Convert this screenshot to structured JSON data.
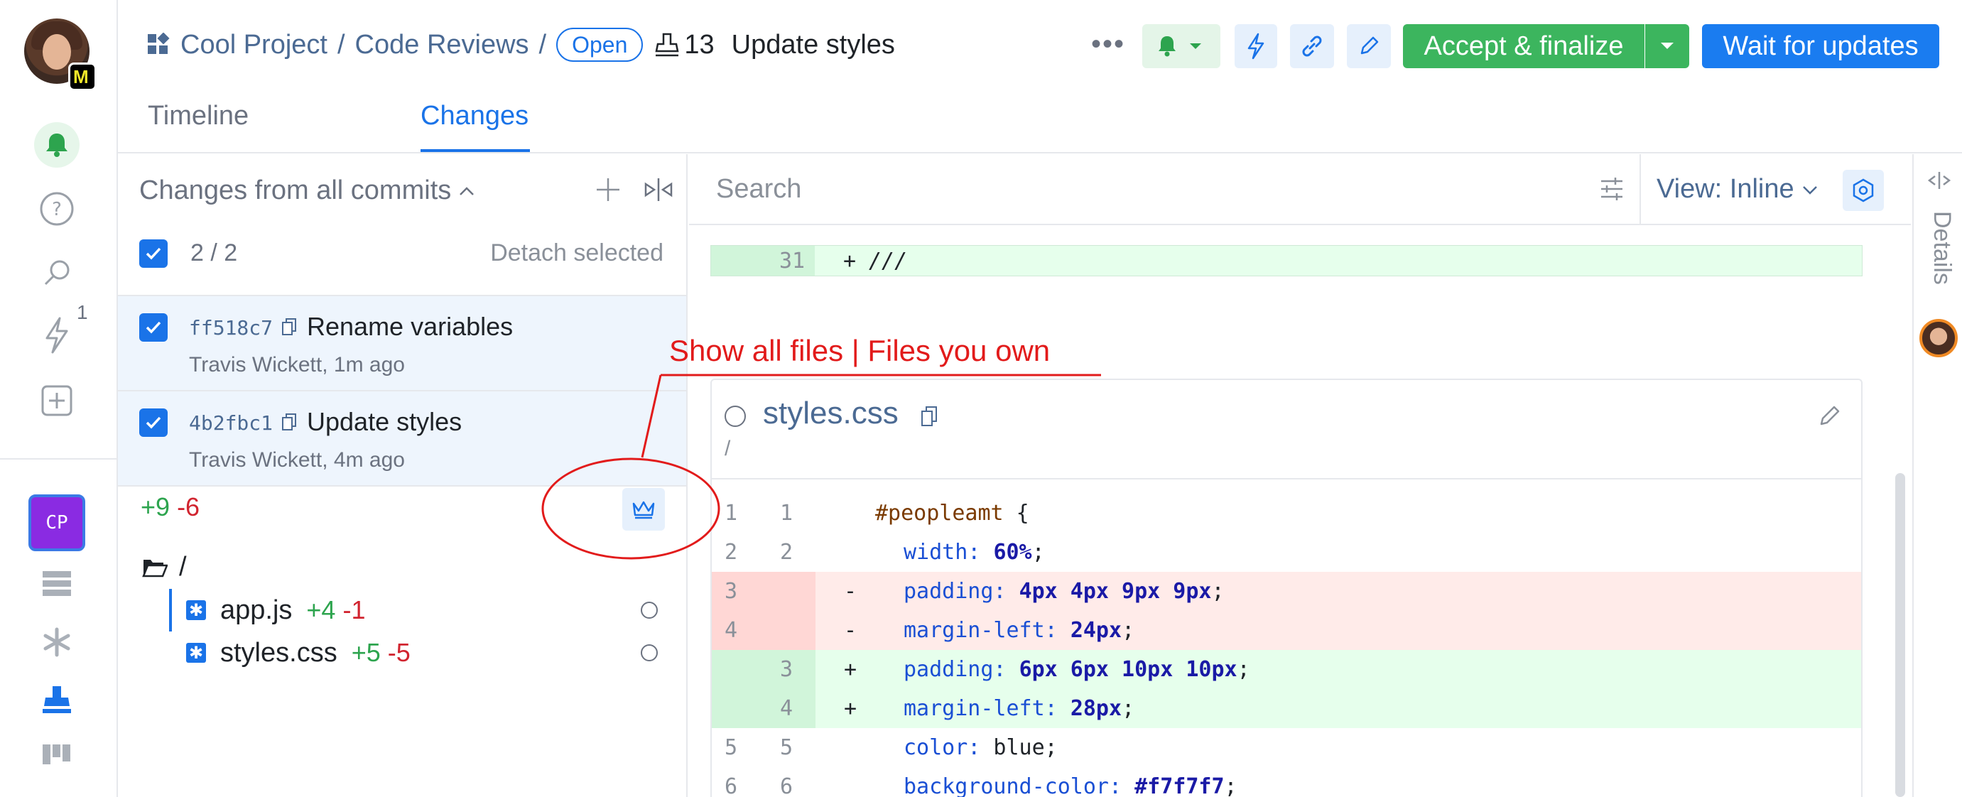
{
  "rail": {
    "notification_count": "1",
    "project_badge": "CP"
  },
  "header": {
    "project": "Cool Project",
    "separator": "/",
    "section": "Code Reviews",
    "status": "Open",
    "review_number": "13",
    "review_title": "Update styles",
    "more": "•••",
    "accept_label": "Accept & finalize",
    "wait_label": "Wait for updates"
  },
  "tabs": [
    {
      "label": "Timeline"
    },
    {
      "label": "Changes"
    }
  ],
  "changes_panel": {
    "title": "Changes from all commits",
    "selected_count": "2 / 2",
    "detach_label": "Detach selected",
    "commits": [
      {
        "hash": "ff518c7",
        "message": "Rename variables",
        "meta": "Travis Wickett, 1m ago"
      },
      {
        "hash": "4b2fbc1",
        "message": "Update styles",
        "meta": "Travis Wickett, 4m ago"
      }
    ],
    "total_added": "+9",
    "total_removed": "-6",
    "root_folder": "/",
    "files": [
      {
        "name": "app.js",
        "added": "+4",
        "removed": "-1"
      },
      {
        "name": "styles.css",
        "added": "+5",
        "removed": "-5"
      }
    ]
  },
  "search": {
    "placeholder": "Search"
  },
  "view": {
    "label": "View: Inline"
  },
  "diff": {
    "top_line": {
      "new": "31",
      "sign": "+",
      "code": "///"
    },
    "file_name": "styles.css",
    "file_path": "/",
    "lines": [
      {
        "type": "ctx",
        "old": "1",
        "new": "1",
        "sign": "",
        "parts": [
          [
            "sel",
            "#peopleamt"
          ],
          [
            "",
            " {"
          ]
        ],
        "indent": 0
      },
      {
        "type": "ctx",
        "old": "2",
        "new": "2",
        "sign": "",
        "parts": [
          [
            "prop",
            "width:"
          ],
          [
            "",
            " "
          ],
          [
            "num",
            "60%"
          ],
          [
            "",
            ";"
          ]
        ],
        "indent": 1
      },
      {
        "type": "del",
        "old": "3",
        "new": "",
        "sign": "-",
        "parts": [
          [
            "prop",
            "padding:"
          ],
          [
            "",
            " "
          ],
          [
            "num",
            "4px 4px 9px 9px"
          ],
          [
            "",
            ";"
          ]
        ],
        "indent": 1
      },
      {
        "type": "del",
        "old": "4",
        "new": "",
        "sign": "-",
        "parts": [
          [
            "prop",
            "margin-left:"
          ],
          [
            "",
            " "
          ],
          [
            "num",
            "24px"
          ],
          [
            "",
            ";"
          ]
        ],
        "indent": 1
      },
      {
        "type": "add",
        "old": "",
        "new": "3",
        "sign": "+",
        "parts": [
          [
            "prop",
            "padding:"
          ],
          [
            "",
            " "
          ],
          [
            "num",
            "6px 6px 10px 10px"
          ],
          [
            "",
            ";"
          ]
        ],
        "indent": 1
      },
      {
        "type": "add",
        "old": "",
        "new": "4",
        "sign": "+",
        "parts": [
          [
            "prop",
            "margin-left:"
          ],
          [
            "",
            " "
          ],
          [
            "num",
            "28px"
          ],
          [
            "",
            ";"
          ]
        ],
        "indent": 1
      },
      {
        "type": "ctx",
        "old": "5",
        "new": "5",
        "sign": "",
        "parts": [
          [
            "prop",
            "color:"
          ],
          [
            "",
            " blue;"
          ]
        ],
        "indent": 1
      },
      {
        "type": "ctx",
        "old": "6",
        "new": "6",
        "sign": "",
        "parts": [
          [
            "prop",
            "background-color:"
          ],
          [
            "",
            " "
          ],
          [
            "num",
            "#f7f7f7"
          ],
          [
            "",
            ";"
          ]
        ],
        "indent": 1
      }
    ]
  },
  "details": {
    "label": "Details"
  },
  "annotation": {
    "text": "Show all files  |  Files you own",
    "color": "#e21b1b"
  },
  "colors": {
    "accent": "#1a73e8",
    "accept": "#3cb55e",
    "added": "#2da44e",
    "removed": "#d1242f"
  }
}
